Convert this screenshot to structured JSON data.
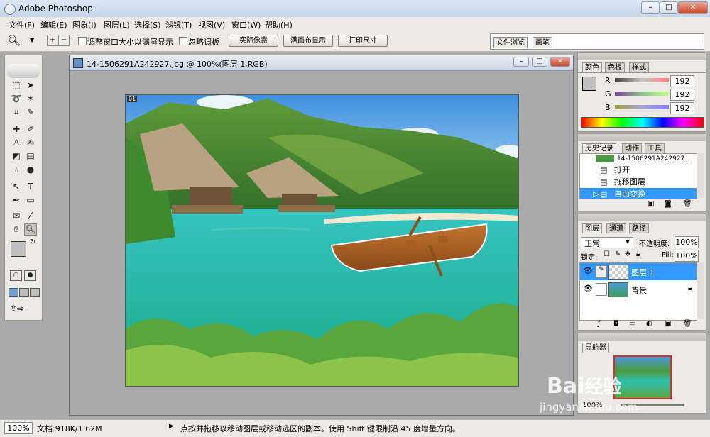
{
  "app": {
    "title": "Adobe Photoshop",
    "window_buttons": [
      "–",
      "□",
      "✕"
    ]
  },
  "menu": [
    "文件(F)",
    "编辑(E)",
    "图象(I)",
    "图层(L)",
    "选择(S)",
    "滤镜(T)",
    "视图(V)",
    "窗口(W)",
    "帮助(H)"
  ],
  "options": {
    "resize_window_label": "调整窗口大小以满屏显示",
    "ignore_palettes_label": "忽略调板",
    "actual_pixels_btn": "实际像素",
    "fit_on_screen_btn": "满画布显示",
    "print_size_btn": "打印尺寸",
    "well_tabs": [
      "文件浏览",
      "画笔"
    ]
  },
  "document": {
    "title": "14-1506291A242927.jpg @ 100%(图层 1,RGB)",
    "corner_badge": "01"
  },
  "color_panel": {
    "tabs": [
      "颜色",
      "色板",
      "样式"
    ],
    "channels": [
      {
        "label": "R",
        "value": "192",
        "gradient": "#c4c4c4"
      },
      {
        "label": "G",
        "value": "192",
        "gradient": "#8bc48b"
      },
      {
        "label": "B",
        "value": "192",
        "gradient": "#a7a7d0"
      }
    ]
  },
  "history_panel": {
    "tabs": [
      "历史记录",
      "动作",
      "工具"
    ],
    "snapshot_name": "14-1506291A242927...",
    "items": [
      "打开",
      "拖移图层",
      "自由变换"
    ],
    "selected_index": 2
  },
  "layers_panel": {
    "tabs": [
      "图层",
      "通道",
      "路径"
    ],
    "blend_mode": "正常",
    "opacity_label": "不透明度:",
    "opacity_value": "100%",
    "lock_label": "锁定:",
    "fill_label": "Fill:",
    "fill_value": "100%",
    "layers": [
      {
        "name": "图层 1",
        "selected": true
      },
      {
        "name": "背景",
        "selected": false,
        "locked": true
      }
    ]
  },
  "navigator_panel": {
    "tabs": [
      "导航器"
    ],
    "zoom": "100%"
  },
  "status": {
    "zoom": "100%",
    "doc_info": "文档:918K/1.62M",
    "hint": "点按并拖移以移动图层或移动选区的副本。使用 Shift 键限制沿 45 度增量方向。"
  },
  "watermark": {
    "line1": "Bai",
    "line2": "经验",
    "url": "jingyan.baidu.com"
  },
  "colors": {
    "accent": "#3399ff",
    "selection": "#3d8ee6"
  }
}
